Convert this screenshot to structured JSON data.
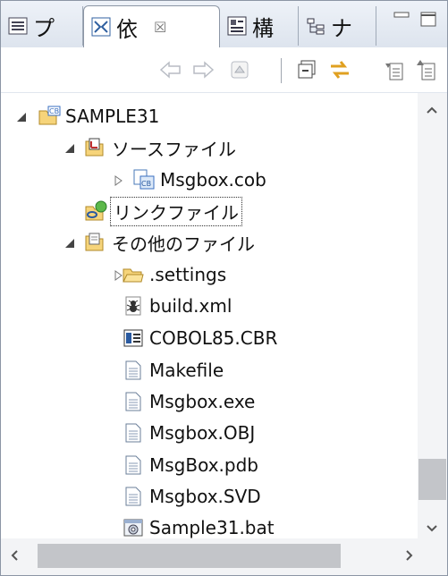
{
  "tabs": [
    {
      "label": "プ",
      "icon": "project-explorer-icon",
      "active": false
    },
    {
      "label": "依",
      "icon": "dependency-icon",
      "active": true,
      "close": "☒"
    },
    {
      "label": "構",
      "icon": "structure-icon",
      "active": false
    },
    {
      "label": "ナ",
      "icon": "navigator-icon",
      "active": false
    }
  ],
  "window_controls": {
    "minimize": "minimize-icon",
    "maximize": "maximize-icon"
  },
  "toolbar": [
    "back-arrow-icon",
    "forward-arrow-icon",
    "home-icon",
    "collapse-all-icon",
    "link-with-editor-icon",
    "view-menu-icon",
    "filter-icon"
  ],
  "tree": {
    "project": "SAMPLE31",
    "source_folder": "ソースファイル",
    "source_files": [
      "Msgbox.cob"
    ],
    "link_files": "リンクファイル",
    "other_folder": "その他のファイル",
    "other_items": [
      {
        "name": ".settings",
        "icon": "folder-icon",
        "expandable": true
      },
      {
        "name": "build.xml",
        "icon": "ant-build-icon",
        "expandable": false
      },
      {
        "name": "COBOL85.CBR",
        "icon": "config-file-icon",
        "expandable": false
      },
      {
        "name": "Makefile",
        "icon": "text-file-icon",
        "expandable": false
      },
      {
        "name": "Msgbox.exe",
        "icon": "text-file-icon",
        "expandable": false
      },
      {
        "name": "Msgbox.OBJ",
        "icon": "text-file-icon",
        "expandable": false
      },
      {
        "name": "MsgBox.pdb",
        "icon": "text-file-icon",
        "expandable": false
      },
      {
        "name": "Msgbox.SVD",
        "icon": "text-file-icon",
        "expandable": false
      },
      {
        "name": "Sample31.bat",
        "icon": "batch-file-icon",
        "expandable": false
      }
    ]
  },
  "colors": {
    "border": "#8c96a5",
    "tab_bg": "#dde4ee",
    "scroll_thumb": "#c3c5c9",
    "accent": "#e8a020"
  }
}
